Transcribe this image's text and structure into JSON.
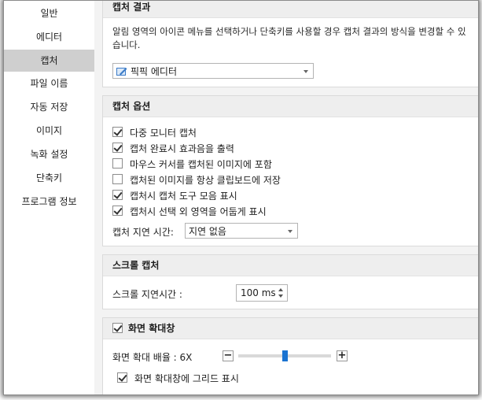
{
  "sidebar": {
    "items": [
      {
        "label": "일반"
      },
      {
        "label": "에디터"
      },
      {
        "label": "캡처"
      },
      {
        "label": "파일 이름"
      },
      {
        "label": "자동 저장"
      },
      {
        "label": "이미지"
      },
      {
        "label": "녹화 설정"
      },
      {
        "label": "단축키"
      },
      {
        "label": "프로그램 정보"
      }
    ],
    "active_index": 2
  },
  "capture_result": {
    "title": "캡처 결과",
    "description": "알림 영역의 아이콘 메뉴를 선택하거나 단축키를 사용할 경우 캡처 결과의 방식을 변경할 수 있습니다.",
    "dropdown_value": "픽픽 에디터",
    "dropdown_icon": "editor-pen-icon"
  },
  "capture_options": {
    "title": "캡처 옵션",
    "checkboxes": [
      {
        "label": "다중 모니터 캡처",
        "checked": true
      },
      {
        "label": "캡처 완료시 효과음을 출력",
        "checked": true
      },
      {
        "label": "마우스 커서를 캡처된 이미지에 포함",
        "checked": false
      },
      {
        "label": "캡처된 이미지를 항상 클립보드에 저장",
        "checked": false
      },
      {
        "label": "캡처시 캡처 도구 모음 표시",
        "checked": true
      },
      {
        "label": "캡처시 선택 외 영역을 어둡게 표시",
        "checked": true
      }
    ],
    "delay_label": "캡처 지연 시간:",
    "delay_value": "지연 없음"
  },
  "scroll_capture": {
    "title": "스크롤 캡처",
    "delay_label": "스크롤 지연시간 :",
    "delay_value": "100 ms"
  },
  "magnifier": {
    "title": "화면 확대창",
    "enabled": true,
    "zoom_label": "화면 확대 배율 : 6X",
    "zoom_minus": "−",
    "zoom_plus": "+",
    "zoom_slider_fraction": 0.5,
    "grid_label": "화면 확대창에 그리드 표시",
    "grid_checked": true
  }
}
